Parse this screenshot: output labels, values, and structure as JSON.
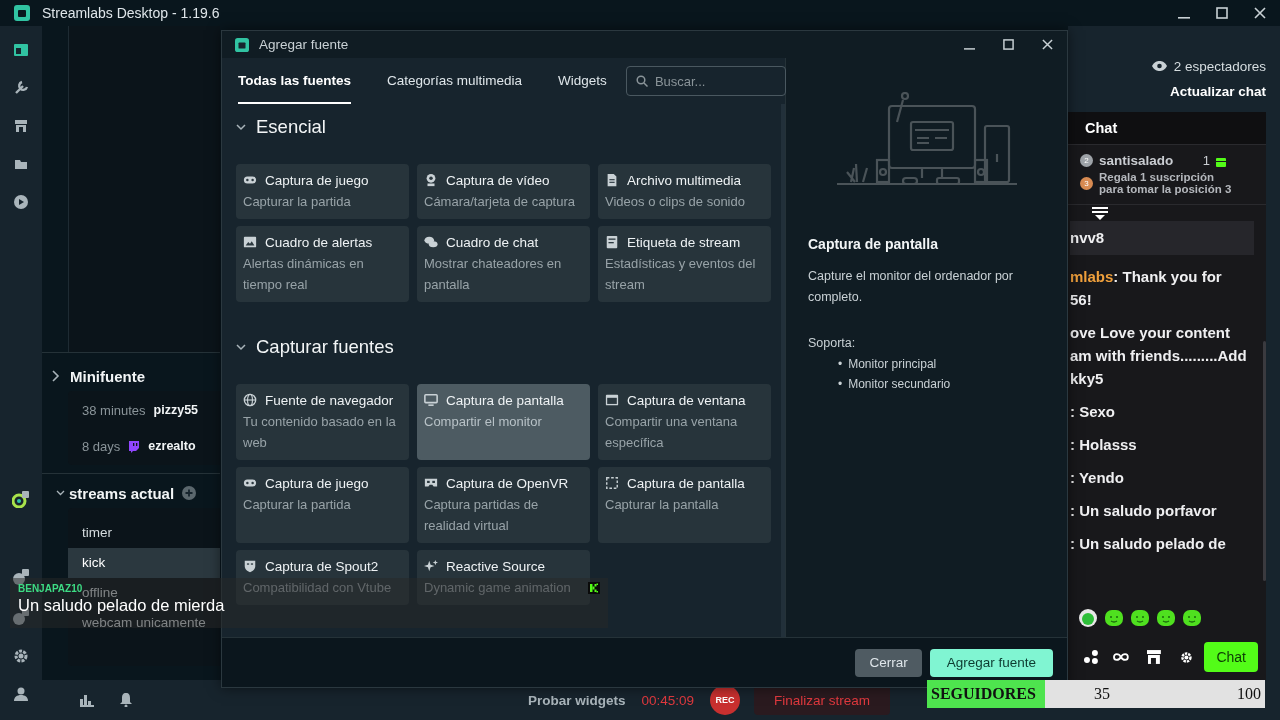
{
  "app_title": "Streamlabs Desktop - 1.19.6",
  "mini_source": {
    "title": "Minifuente",
    "items": [
      {
        "time": "38 minutes",
        "name": "pizzy55",
        "kind": "plain"
      },
      {
        "time": "8 days",
        "name": "ezrealto",
        "kind": "twitch"
      }
    ]
  },
  "scene_collection": {
    "title": "streams actual",
    "items": [
      {
        "label": "timer",
        "selected": false
      },
      {
        "label": "kick",
        "selected": true
      },
      {
        "label": "offline",
        "selected": false
      },
      {
        "label": "webcam unicamente",
        "selected": false
      }
    ]
  },
  "bottom_bar": {
    "test_widgets": "Probar widgets",
    "timer": "00:45:09",
    "rec": "REC",
    "end_stream": "Finalizar stream"
  },
  "dialog": {
    "title": "Agregar fuente",
    "tabs": [
      {
        "label": "Todas las fuentes",
        "selected": true
      },
      {
        "label": "Categorías multimedia",
        "selected": false
      },
      {
        "label": "Widgets",
        "selected": false
      }
    ],
    "search": {
      "placeholder": "Buscar..."
    },
    "sections": [
      {
        "title": "Esencial",
        "expanded": true,
        "sources": [
          {
            "kind": "gamepad",
            "title": "Captura de juego",
            "description": "Capturar la partida",
            "selected": false
          },
          {
            "kind": "webcam",
            "title": "Captura de vídeo",
            "description": "Cámara/tarjeta de captura",
            "selected": false
          },
          {
            "kind": "file",
            "title": "Archivo multimedia",
            "description": "Videos o clips de sonido",
            "selected": false
          },
          {
            "kind": "image",
            "title": "Cuadro de alertas",
            "description": "Alertas dinámicas en tiempo real",
            "selected": false
          },
          {
            "kind": "chat",
            "title": "Cuadro de chat",
            "description": "Mostrar chateadores en pantalla",
            "selected": false
          },
          {
            "kind": "tag",
            "title": "Etiqueta de stream",
            "description": "Estadísticas y eventos del stream",
            "selected": false
          }
        ]
      },
      {
        "title": "Capturar fuentes",
        "expanded": true,
        "sources": [
          {
            "kind": "globe",
            "title": "Fuente de navegador",
            "description": "Tu contenido basado en la web",
            "selected": false
          },
          {
            "kind": "monitor",
            "title": "Captura de pantalla",
            "description": "Compartir el monitor",
            "selected": true
          },
          {
            "kind": "window",
            "title": "Captura de ventana",
            "description": "Compartir una ventana específica",
            "selected": false
          },
          {
            "kind": "gamepad",
            "title": "Captura de juego",
            "description": "Capturar la partida",
            "selected": false
          },
          {
            "kind": "vr",
            "title": "Captura de OpenVR",
            "description": "Captura partidas de realidad virtual",
            "selected": false
          },
          {
            "kind": "region",
            "title": "Captura de pantalla",
            "description": "Capturar la pantalla",
            "selected": false
          },
          {
            "kind": "mask",
            "title": "Captura de Spout2",
            "description": "Compatibilidad con Vtube",
            "selected": false
          },
          {
            "kind": "sparkle",
            "title": "Reactive Source",
            "description": "Dynamic game animation",
            "selected": false
          }
        ]
      }
    ],
    "detail": {
      "title": "Captura de pantalla",
      "description": "Capture el monitor del ordenador por completo.",
      "supports_label": "Soporta:",
      "bullet": "•",
      "supports": [
        "Monitor principal",
        "Monitor secundario"
      ]
    },
    "buttons": [
      {
        "label": "Cerrar",
        "kind": "secondary"
      },
      {
        "label": "Agregar fuente",
        "kind": "primary"
      }
    ]
  },
  "chat": {
    "viewers": "2 espectadores",
    "refresh": "Actualizar chat",
    "title": "Chat",
    "top_gifters": [
      {
        "rank": "2",
        "color": "#9ea3a8",
        "name": "santisalado",
        "count": "1"
      },
      {
        "rank": "3",
        "color": "#d98b52",
        "text": "Regala 1 suscripción para tomar la posición 3"
      }
    ],
    "messages": [
      {
        "kind": "system",
        "lines": [
          "nvv8"
        ]
      },
      {
        "kind": "user",
        "user": "mlabs",
        "color": "#f0a03c",
        "lines": [
          ": Thank you for",
          "56!"
        ]
      },
      {
        "kind": "plain",
        "lines": [
          "ove Love your content",
          "am with friends.........Add",
          "kky5"
        ]
      },
      {
        "kind": "plain",
        "lines": [
          ": Sexo"
        ]
      },
      {
        "kind": "plain",
        "lines": [
          ": Holasss"
        ]
      },
      {
        "kind": "plain",
        "lines": [
          ": Yendo"
        ]
      },
      {
        "kind": "plain",
        "lines": [
          ": Un saludo porfavor"
        ]
      },
      {
        "kind": "plain",
        "lines": [
          ": Un saludo pelado de"
        ]
      }
    ],
    "send_button": "Chat"
  },
  "alert_overlay": {
    "user": "BENJAPAZ10",
    "message": "Un saludo pelado de mierda"
  },
  "follower_goal": {
    "label": "SEGUIDORES",
    "current": "35",
    "target": "100",
    "level": 0.35
  }
}
